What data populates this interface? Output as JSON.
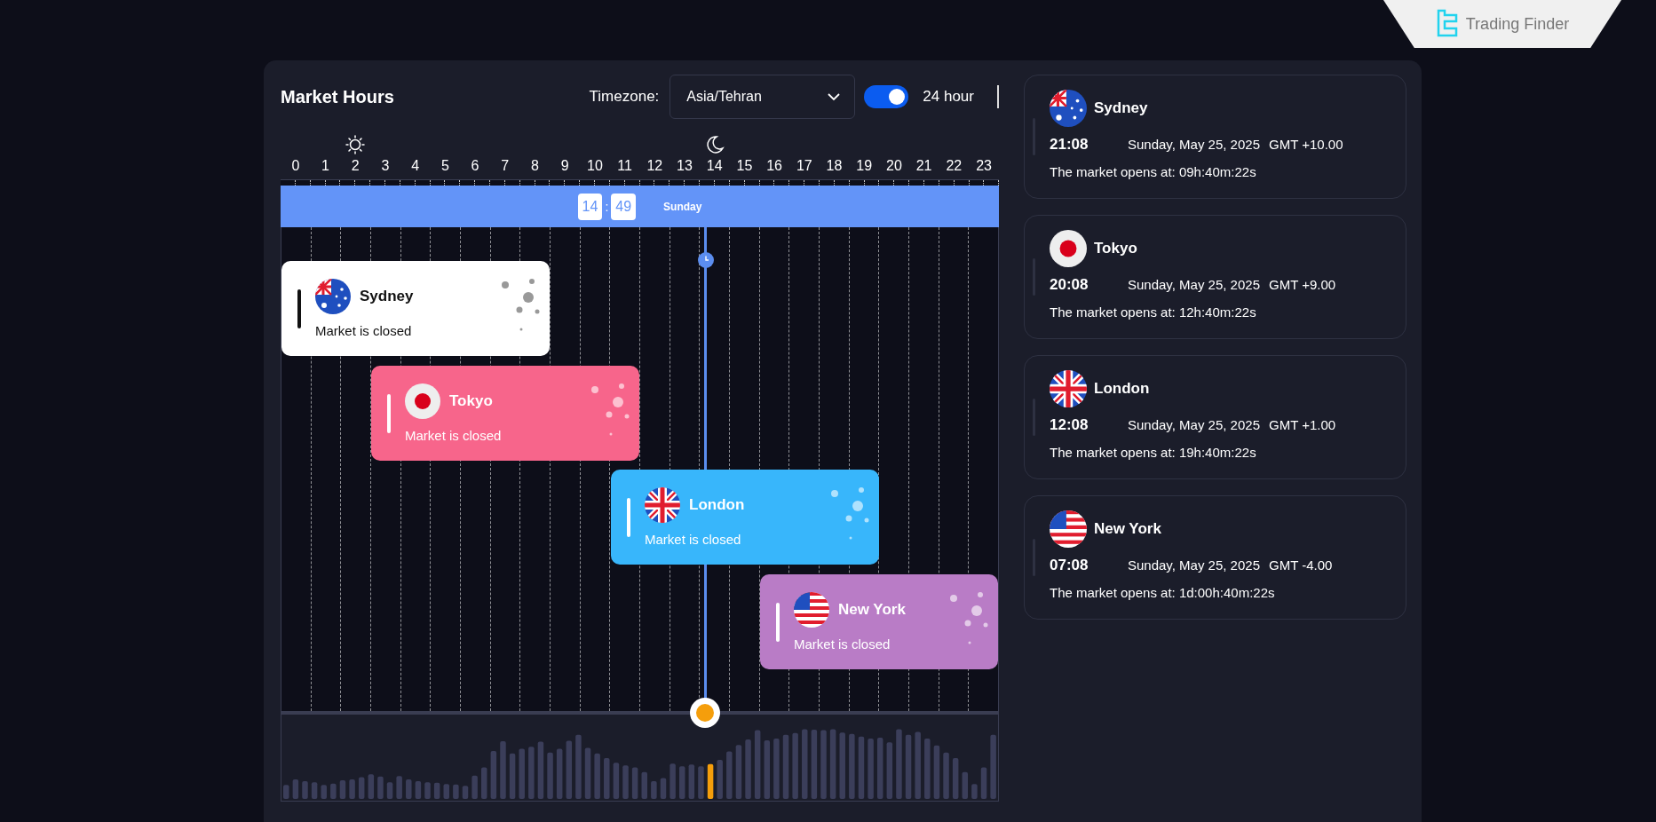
{
  "brand": {
    "name": "Trading Finder"
  },
  "header": {
    "title": "Market Hours",
    "timezone_label": "Timezone:",
    "timezone": "Asia/Tehran",
    "format_toggle": {
      "on": true,
      "label": "24 hour"
    }
  },
  "hours": [
    "0",
    "1",
    "2",
    "3",
    "4",
    "5",
    "6",
    "7",
    "8",
    "9",
    "10",
    "11",
    "12",
    "13",
    "14",
    "15",
    "16",
    "17",
    "18",
    "19",
    "20",
    "21",
    "22",
    "23"
  ],
  "now_bar": {
    "hour": "14",
    "separator": ":",
    "minute": "49",
    "day": "Sunday"
  },
  "sessions": [
    {
      "city": "Sydney",
      "kind": "australia",
      "status": "Market is closed",
      "color": "#ffffff"
    },
    {
      "city": "Tokyo",
      "kind": "japan",
      "status": "Market is closed",
      "color": "#f7658b"
    },
    {
      "city": "London",
      "kind": "uk",
      "status": "Market is closed",
      "color": "#38b6fb"
    },
    {
      "city": "New York",
      "kind": "usa",
      "status": "Market is closed",
      "color": "#b97cc6"
    }
  ],
  "markets": [
    {
      "city": "Sydney",
      "kind": "australia",
      "time": "21:08",
      "date": "Sunday, May 25, 2025",
      "gmt": "GMT +10.00",
      "countdown": "The market opens at: 09h:40m:22s"
    },
    {
      "city": "Tokyo",
      "kind": "japan",
      "time": "20:08",
      "date": "Sunday, May 25, 2025",
      "gmt": "GMT +9.00",
      "countdown": "The market opens at: 12h:40m:22s"
    },
    {
      "city": "London",
      "kind": "uk",
      "time": "12:08",
      "date": "Sunday, May 25, 2025",
      "gmt": "GMT +1.00",
      "countdown": "The market opens at: 19h:40m:22s"
    },
    {
      "city": "New York",
      "kind": "usa",
      "time": "07:08",
      "date": "Sunday, May 25, 2025",
      "gmt": "GMT -4.00",
      "countdown": "The market opens at: 1d:00h:40m:22s"
    }
  ]
}
